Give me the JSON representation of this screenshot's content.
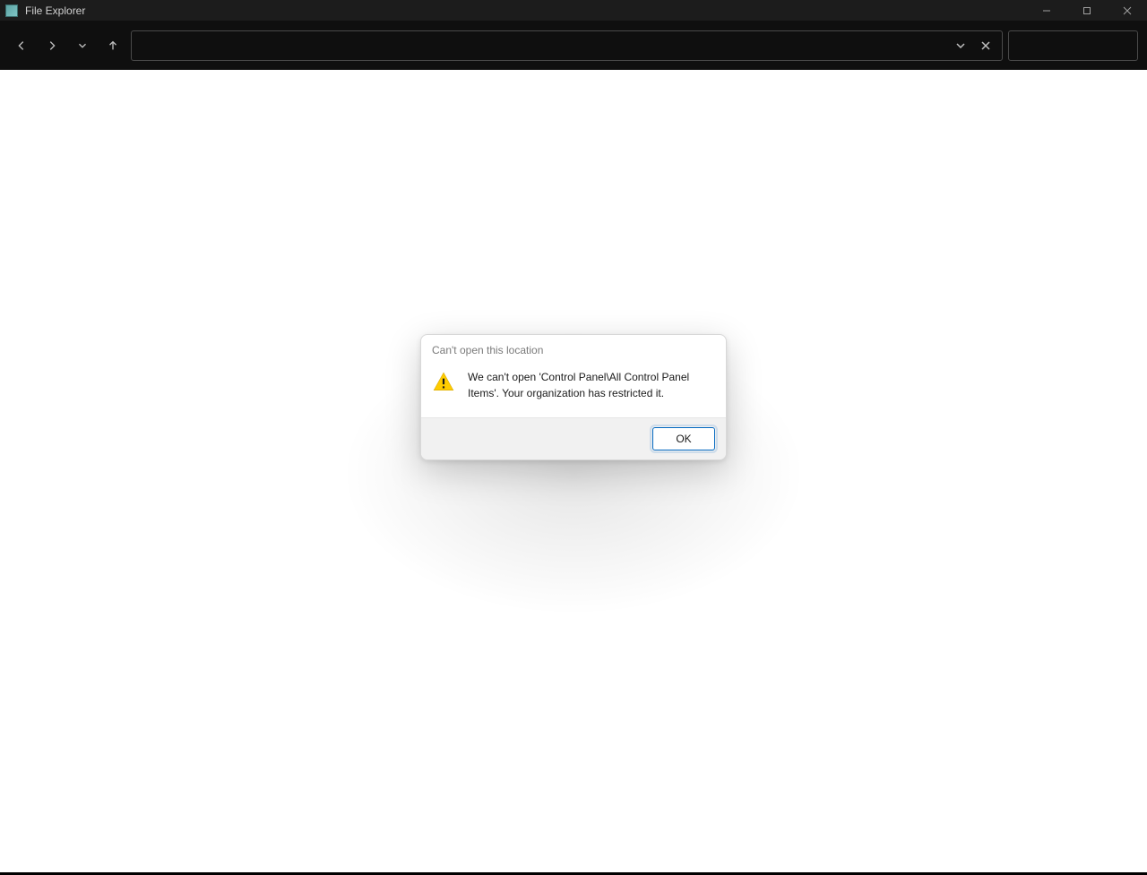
{
  "window": {
    "title": "File Explorer"
  },
  "address": {
    "value": ""
  },
  "search": {
    "placeholder": ""
  },
  "dialog": {
    "title": "Can't open this location",
    "message": "We can't open 'Control Panel\\All Control Panel Items'. Your organization has restricted it.",
    "ok_label": "OK"
  }
}
